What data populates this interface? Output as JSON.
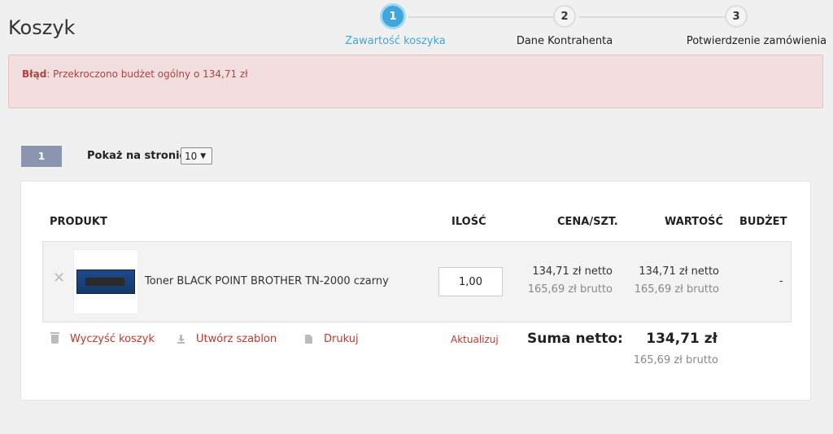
{
  "page": {
    "title": "Koszyk"
  },
  "steps": [
    {
      "number": "1",
      "label": "Zawartość koszyka",
      "active": true
    },
    {
      "number": "2",
      "label": "Dane Kontrahenta",
      "active": false
    },
    {
      "number": "3",
      "label": "Potwierdzenie zamówienia",
      "active": false
    }
  ],
  "alert": {
    "prefix": "Błąd",
    "message": ": Przekroczono budżet ogólny o 134,71 zł"
  },
  "pagination": {
    "current_page": "1",
    "per_page_label": "Pokaż na stronie",
    "per_page_value": "10"
  },
  "table": {
    "headers": {
      "product": "PRODUKT",
      "qty": "ILOŚĆ",
      "price": "CENA/SZT.",
      "value": "WARTOŚĆ",
      "budget": "BUDŻET"
    },
    "rows": [
      {
        "name": "Toner BLACK POINT BROTHER TN-2000 czarny",
        "qty": "1,00",
        "price_netto": "134,71 zł netto",
        "price_brutto": "165,69 zł brutto",
        "value_netto": "134,71 zł netto",
        "value_brutto": "165,69 zł brutto",
        "budget": "-"
      }
    ]
  },
  "actions": {
    "clear_cart": "Wyczyść koszyk",
    "create_template": "Utwórz szablon",
    "print": "Drukuj",
    "update": "Aktualizuj"
  },
  "summary": {
    "label": "Suma netto:",
    "netto": "134,71 zł",
    "brutto": "165,69 zł brutto"
  },
  "colors": {
    "accent": "#3fa7dc",
    "error_text": "#a94442",
    "error_bg": "#f2dede",
    "link_red": "#c0392b",
    "pager": "#8a95b0"
  }
}
